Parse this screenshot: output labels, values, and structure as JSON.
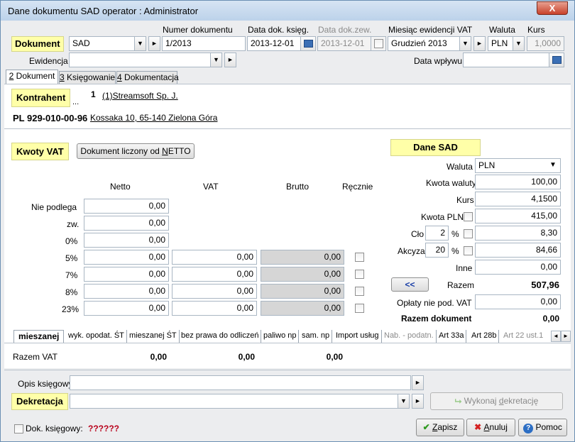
{
  "window": {
    "title": "Dane dokumentu SAD    operator : Administrator",
    "close_label": "X"
  },
  "header": {
    "dokument_label": "Dokument",
    "dokument_value": "SAD",
    "numer_label": "Numer dokumentu",
    "numer_value": "1/2013",
    "data_ksieg_label": "Data dok. księg.",
    "data_ksieg_value": "2013-12-01",
    "data_zew_label": "Data dok.zew.",
    "data_zew_value": "2013-12-01",
    "miesiac_label": "Miesiąc ewidencji VAT",
    "miesiac_value": "Grudzień 2013",
    "waluta_label": "Waluta",
    "waluta_value": "PLN",
    "kurs_label": "Kurs",
    "kurs_value": "1,0000",
    "ewidencja_label": "Ewidencja",
    "ewidencja_value": "",
    "data_wplywu_label": "Data wpływu",
    "data_wplywu_value": ""
  },
  "tabs": [
    {
      "hot": "2",
      "rest": " Dokument"
    },
    {
      "hot": "3",
      "rest": " Księgowanie"
    },
    {
      "hot": "4",
      "rest": " Dokumentacja"
    }
  ],
  "kontrahent": {
    "label": "Kontrahent",
    "ellipsis": "...",
    "number": "1",
    "name": "(1)Streamsoft Sp. J.",
    "nip": "PL 929-010-00-96",
    "address": "Kossaka 10, 65-140 Zielona Góra"
  },
  "kwoty": {
    "label": "Kwoty VAT",
    "netto_btn_pre": "Dokument liczony od ",
    "netto_btn_hot": "N",
    "netto_btn_post": "ETTO",
    "col_netto": "Netto",
    "col_vat": "VAT",
    "col_brutto": "Brutto",
    "col_recznie": "Ręcznie",
    "rows": [
      {
        "label": "Nie podlega",
        "netto": "0,00"
      },
      {
        "label": "zw.",
        "netto": "0,00"
      },
      {
        "label": "0%",
        "netto": "0,00"
      },
      {
        "label": "5%",
        "netto": "0,00",
        "vat": "0,00",
        "brutto": "0,00"
      },
      {
        "label": "7%",
        "netto": "0,00",
        "vat": "0,00",
        "brutto": "0,00"
      },
      {
        "label": "8%",
        "netto": "0,00",
        "vat": "0,00",
        "brutto": "0,00"
      },
      {
        "label": "23%",
        "netto": "0,00",
        "vat": "0,00",
        "brutto": "0,00"
      }
    ]
  },
  "sad": {
    "label": "Dane SAD",
    "waluta_label": "Waluta",
    "waluta_value": "PLN",
    "kwota_waluty_label": "Kwota waluty",
    "kwota_waluty_value": "100,00",
    "kurs_label": "Kurs",
    "kurs_value": "4,1500",
    "kwota_pln_label": "Kwota PLN",
    "kwota_pln_value": "415,00",
    "clo_label": "Cło",
    "clo_pct": "2",
    "clo_value": "8,30",
    "akcyza_label": "Akcyza",
    "akcyza_pct": "20",
    "akcyza_value": "84,66",
    "inne_label": "Inne",
    "inne_value": "0,00",
    "back_btn": "<<",
    "razem_label": "Razem",
    "razem_value": "507,96",
    "oplaty_label": "Opłaty nie pod. VAT",
    "oplaty_value": "0,00",
    "razem_dok_label": "Razem dokument",
    "razem_dok_value": "0,00",
    "pct_sign": "%"
  },
  "inner_tabs": [
    "mieszanej",
    "wyk. opodat. ŚT",
    "mieszanej ŚT",
    "bez prawa do odliczeń",
    "paliwo np",
    "sam. np",
    "Import usług",
    "Nab. - podatn.",
    "Art 33a",
    "Art 28b",
    "Art 22 ust.1"
  ],
  "razem_vat": {
    "label": "Razem VAT",
    "netto": "0,00",
    "vat": "0,00",
    "brutto": "0,00"
  },
  "opis": {
    "label": "Opis księgowy",
    "value": ""
  },
  "dekretacja": {
    "label": "Dekretacja",
    "value": "",
    "wykonaj_pre": "Wykonaj ",
    "wykonaj_hot": "d",
    "wykonaj_post": "ekretację"
  },
  "footer": {
    "dok_ksiegowy_label": "Dok. księgowy:",
    "dok_ksiegowy_value": "??????",
    "zapisz_hot": "Z",
    "zapisz_rest": "apisz",
    "anuluj_hot": "A",
    "anuluj_rest": "nuluj",
    "pomoc_label": "Pomoc"
  }
}
